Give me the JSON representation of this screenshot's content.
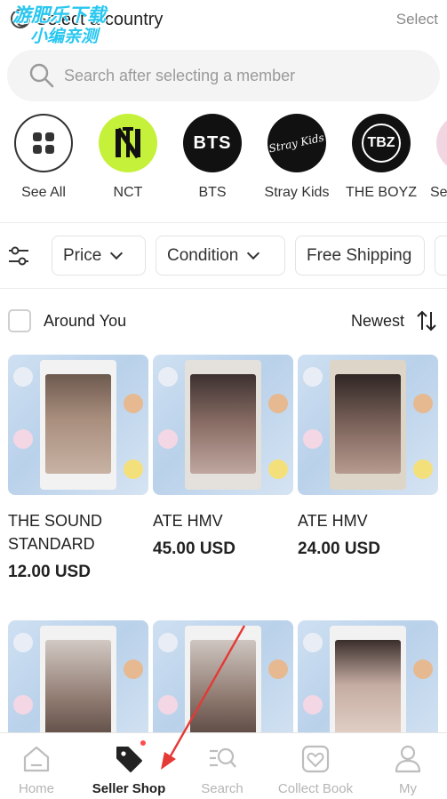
{
  "header": {
    "country_label": "Select a country",
    "select_link": "Select",
    "watermark_line1": "游肥乐下载",
    "watermark_line2": "小编亲测"
  },
  "search": {
    "placeholder": "Search after selecting a member",
    "icon": "search-icon"
  },
  "groups": [
    {
      "label": "See All",
      "icon": "grid-icon"
    },
    {
      "label": "NCT",
      "logo_text": "NCT",
      "bg": "#c5f13a"
    },
    {
      "label": "BTS",
      "logo_text": "BTS",
      "bg": "#111111"
    },
    {
      "label": "Stray Kids",
      "logo_text": "Stray Kids",
      "bg": "#111111"
    },
    {
      "label": "THE BOYZ",
      "logo_text": "TBZ",
      "bg": "#111111"
    },
    {
      "label": "Se",
      "bg": "#f1d6e2"
    }
  ],
  "filters": {
    "icon": "sliders-icon",
    "items": [
      {
        "label": "Price"
      },
      {
        "label": "Condition"
      },
      {
        "label": "Free Shipping"
      }
    ]
  },
  "listing": {
    "around_label": "Around You",
    "around_checked": false,
    "sort_label": "Newest",
    "sort_icon": "sort-arrows-icon"
  },
  "products": [
    {
      "name": "THE SOUND STANDARD",
      "price": "12.00 USD"
    },
    {
      "name": "ATE HMV",
      "price": "45.00 USD"
    },
    {
      "name": "ATE HMV",
      "price": "24.00 USD"
    },
    {
      "name": "",
      "price": ""
    },
    {
      "name": "",
      "price": ""
    },
    {
      "name": "",
      "price": ""
    }
  ],
  "bottom_nav": [
    {
      "label": "Home",
      "icon": "home-icon",
      "active": false
    },
    {
      "label": "Seller Shop",
      "icon": "tag-icon",
      "active": true,
      "badge": true
    },
    {
      "label": "Search",
      "icon": "search-list-icon",
      "active": false
    },
    {
      "label": "Collect Book",
      "icon": "heart-book-icon",
      "active": false
    },
    {
      "label": "My",
      "icon": "person-icon",
      "active": false
    }
  ],
  "colors": {
    "accent_badge": "#ff4d4f",
    "arrow": "#e53935",
    "inactive_nav": "#b5b5b5",
    "watermark": "#28c7f0"
  }
}
